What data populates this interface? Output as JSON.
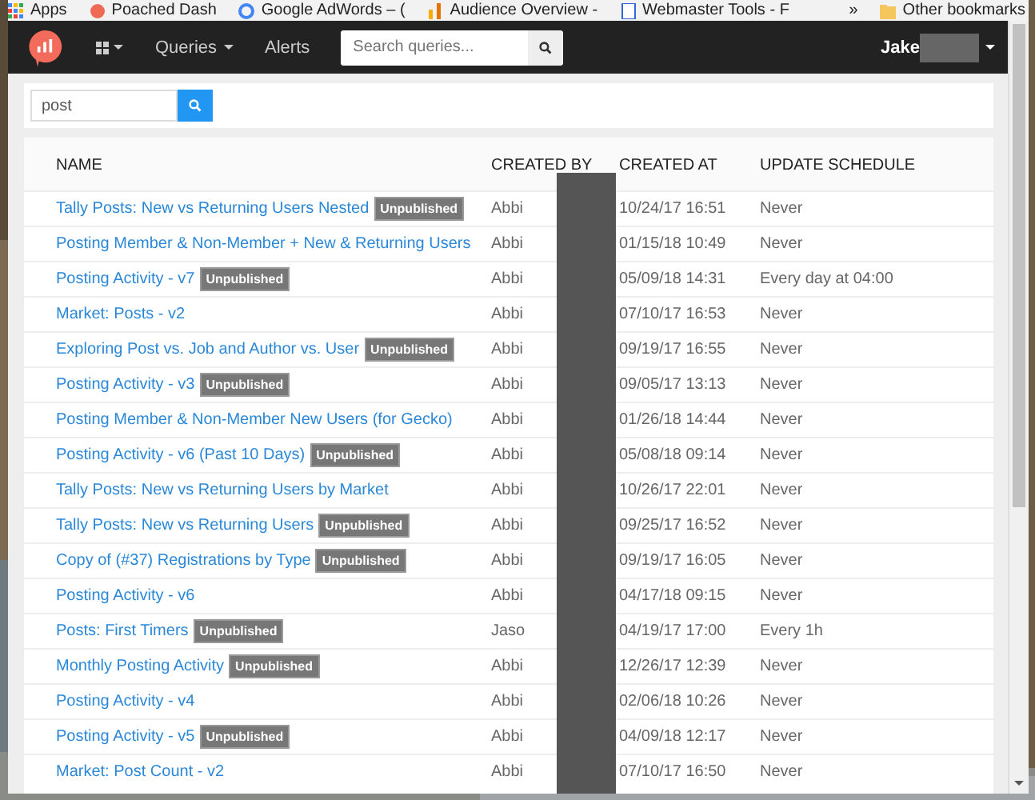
{
  "bookmarks": {
    "items": [
      {
        "label": "Apps",
        "kind": "apps"
      },
      {
        "label": "Poached Dash",
        "kind": "pin"
      },
      {
        "label": "Google AdWords – (",
        "kind": "google"
      },
      {
        "label": "Audience Overview -",
        "kind": "chart"
      },
      {
        "label": "Webmaster Tools - F",
        "kind": "page"
      }
    ],
    "more": "»",
    "other": "Other bookmarks"
  },
  "navbar": {
    "menus": [
      {
        "label": "Queries",
        "caret": true
      },
      {
        "label": "Alerts",
        "caret": false
      }
    ],
    "search": {
      "placeholder": "Search queries..."
    },
    "user": "Jake"
  },
  "filter": {
    "value": "post"
  },
  "table": {
    "columns": [
      "NAME",
      "CREATED BY",
      "CREATED AT",
      "UPDATE SCHEDULE"
    ],
    "rows": [
      {
        "name": "Tally Posts: New vs Returning Users Nested",
        "unpublished": true,
        "badge": "Unpublished",
        "created_by": "Abbi",
        "created_at": "10/24/17 16:51",
        "schedule": "Never"
      },
      {
        "name": "Posting Member & Non-Member + New & Returning Users",
        "unpublished": false,
        "created_by": "Abbi",
        "created_at": "01/15/18 10:49",
        "schedule": "Never"
      },
      {
        "name": "Posting Activity - v7",
        "unpublished": true,
        "badge": "Unpublished",
        "created_by": "Abbi",
        "created_at": "05/09/18 14:31",
        "schedule": "Every day at 04:00"
      },
      {
        "name": "Market: Posts - v2",
        "unpublished": false,
        "created_by": "Abbi",
        "created_at": "07/10/17 16:53",
        "schedule": "Never"
      },
      {
        "name": "Exploring Post vs. Job and Author vs. User",
        "unpublished": true,
        "badge": "Unpublished",
        "created_by": "Abbi",
        "created_at": "09/19/17 16:55",
        "schedule": "Never"
      },
      {
        "name": "Posting Activity - v3",
        "unpublished": true,
        "badge": "Unpublished",
        "created_by": "Abbi",
        "created_at": "09/05/17 13:13",
        "schedule": "Never"
      },
      {
        "name": "Posting Member & Non-Member New Users (for Gecko)",
        "unpublished": false,
        "created_by": "Abbi",
        "created_at": "01/26/18 14:44",
        "schedule": "Never"
      },
      {
        "name": "Posting Activity - v6 (Past 10 Days)",
        "unpublished": true,
        "badge": "Unpublished",
        "created_by": "Abbi",
        "created_at": "05/08/18 09:14",
        "schedule": "Never"
      },
      {
        "name": "Tally Posts: New vs Returning Users by Market",
        "unpublished": false,
        "created_by": "Abbi",
        "created_at": "10/26/17 22:01",
        "schedule": "Never"
      },
      {
        "name": "Tally Posts: New vs Returning Users",
        "unpublished": true,
        "badge": "Unpublished",
        "created_by": "Abbi",
        "created_at": "09/25/17 16:52",
        "schedule": "Never"
      },
      {
        "name": "Copy of (#37) Registrations by Type",
        "unpublished": true,
        "badge": "Unpublished",
        "created_by": "Abbi",
        "created_at": "09/19/17 16:05",
        "schedule": "Never"
      },
      {
        "name": "Posting Activity - v6",
        "unpublished": false,
        "created_by": "Abbi",
        "created_at": "04/17/18 09:15",
        "schedule": "Never"
      },
      {
        "name": "Posts: First Timers",
        "unpublished": true,
        "badge": "Unpublished",
        "created_by": "Jaso",
        "created_at": "04/19/17 17:00",
        "schedule": "Every 1h"
      },
      {
        "name": "Monthly Posting Activity",
        "unpublished": true,
        "badge": "Unpublished",
        "created_by": "Abbi",
        "created_at": "12/26/17 12:39",
        "schedule": "Never"
      },
      {
        "name": "Posting Activity - v4",
        "unpublished": false,
        "created_by": "Abbi",
        "created_at": "02/06/18 10:26",
        "schedule": "Never"
      },
      {
        "name": "Posting Activity - v5",
        "unpublished": true,
        "badge": "Unpublished",
        "created_by": "Abbi",
        "created_at": "04/09/18 12:17",
        "schedule": "Never"
      },
      {
        "name": "Market: Post Count - v2",
        "unpublished": false,
        "created_by": "Abbi",
        "created_at": "07/10/17 16:50",
        "schedule": "Never"
      }
    ]
  }
}
